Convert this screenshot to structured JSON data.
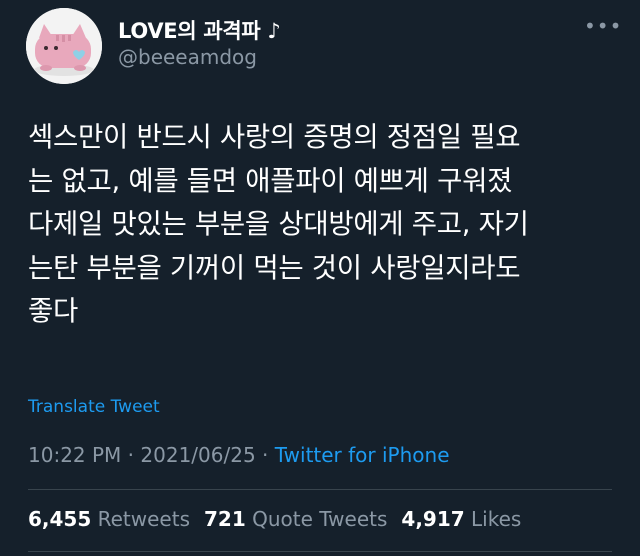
{
  "user": {
    "display_name": "LOVE의 과격파 ♪",
    "handle": "@beeeamdog"
  },
  "tweet": {
    "text": "섹스만이 반드시 사랑의 증명의 정점일 필요\n는 없고, 예를 들면 애플파이 예쁘게 구워졌\n다제일 맛있는 부분을 상대방에게 주고, 자기\n는탄 부분을 기꺼이 먹는 것이 사랑일지라도\n좋다",
    "translate_label": "Translate Tweet",
    "time": "10:22 PM",
    "separator1": " · ",
    "date": "2021/06/25",
    "separator2": " · ",
    "source": "Twitter for iPhone"
  },
  "stats": {
    "retweets_count": "6,455",
    "retweets_label": "Retweets",
    "quote_count": "721",
    "quote_label": "Quote Tweets",
    "likes_count": "4,917",
    "likes_label": "Likes"
  },
  "icons": {
    "more": "more-icon"
  },
  "colors": {
    "background": "#15202b",
    "accent": "#1d9bf0",
    "secondary_text": "#8b98a5"
  }
}
